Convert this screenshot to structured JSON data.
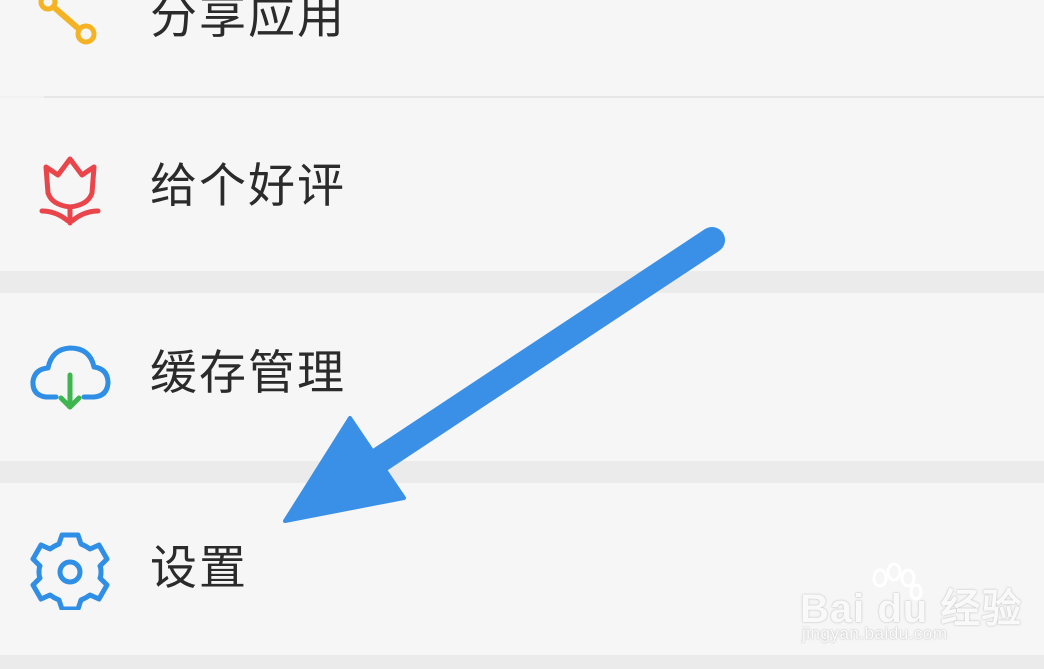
{
  "menu": {
    "items": [
      {
        "label": "分享应用",
        "icon": "share-icon",
        "icon_color": "#f5b323"
      },
      {
        "label": "给个好评",
        "icon": "flower-icon",
        "icon_color": "#e9454a"
      },
      {
        "label": "缓存管理",
        "icon": "cloud-download-icon",
        "icon_color": "#2f8ee6",
        "icon_accent": "#3db64f"
      },
      {
        "label": "设置",
        "icon": "gear-icon",
        "icon_color": "#2f8ee6"
      }
    ]
  },
  "annotation": {
    "arrow_color": "#3a8fe6",
    "points_to": "设置"
  },
  "watermark": {
    "brand": "Bai du 经验",
    "url": "jingyan.baidu.com"
  }
}
